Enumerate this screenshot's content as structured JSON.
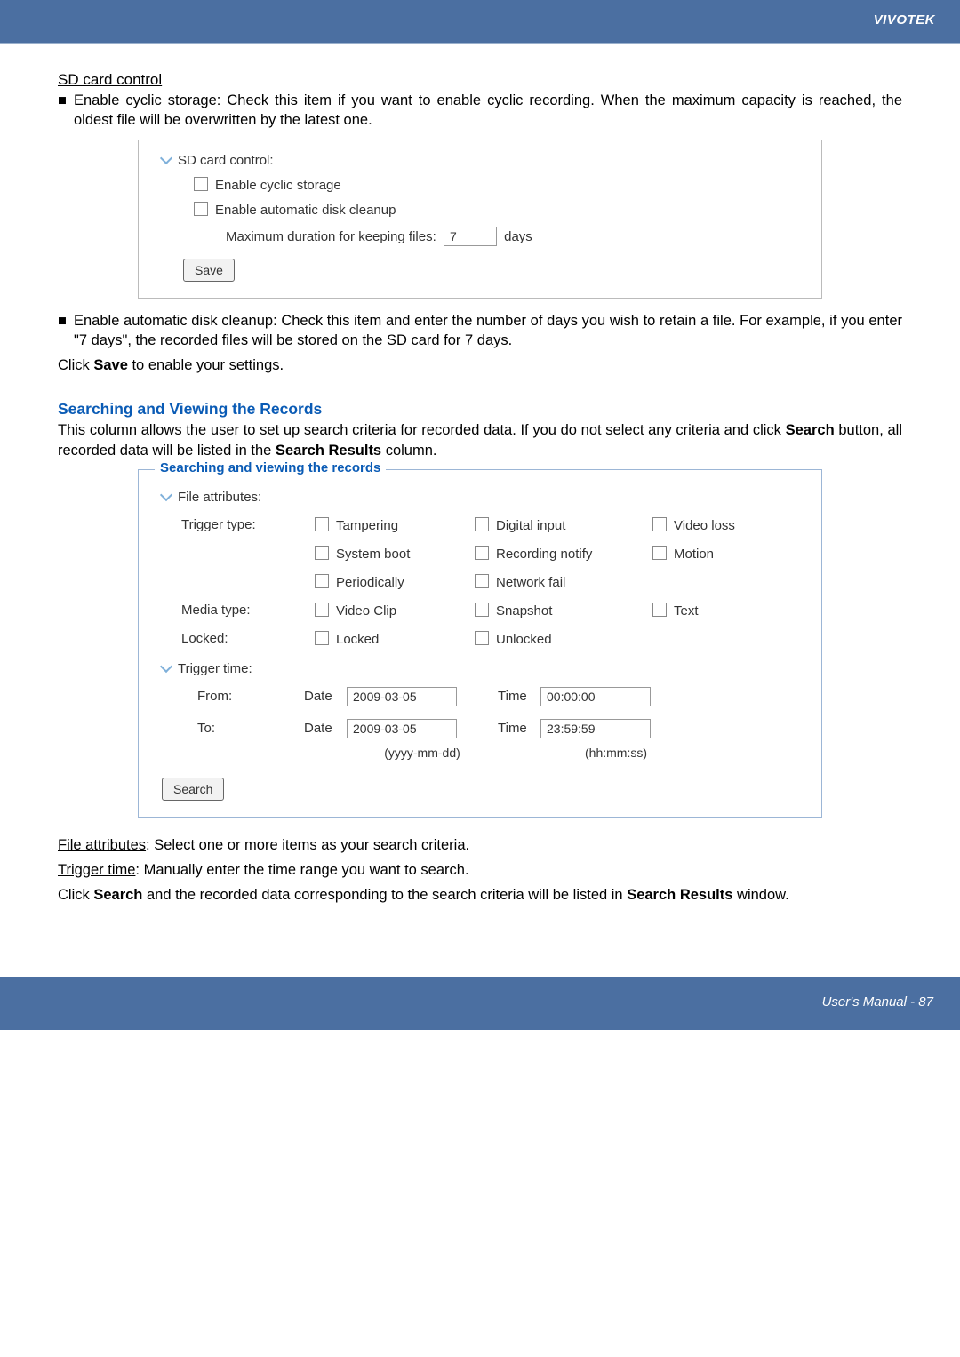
{
  "header": {
    "brand": "VIVOTEK"
  },
  "footer": {
    "text": "User's Manual - 87"
  },
  "sd": {
    "heading": "SD card control",
    "bullet1_a": "Enable cyclic storage: Check this item if you want to enable cyclic recording. When the maximum capacity is reached, the oldest file will be overwritten by the latest one.",
    "box": {
      "title": "SD card control:",
      "opt1": "Enable cyclic storage",
      "opt2": "Enable automatic disk cleanup",
      "mdk_label": "Maximum duration for keeping files:",
      "mdk_value": "7",
      "mdk_unit": "days",
      "save": "Save"
    },
    "bullet2": "Enable automatic disk cleanup: Check this item and enter the number of days you wish to retain a file. For example, if you enter \"7 days\", the recorded files will be stored on the SD card for 7 days.",
    "click_save_pre": "Click ",
    "click_save_bold": "Save",
    "click_save_post": " to enable your settings."
  },
  "search": {
    "title": "Searching and Viewing the Records",
    "intro_pre": "This column allows the user to set up search criteria for recorded data. If you do not select any criteria and click ",
    "intro_b1": "Search",
    "intro_mid": " button, all recorded data will be listed in the ",
    "intro_b2": "Search Results",
    "intro_post": " column.",
    "legend": "Searching and viewing the records",
    "box": {
      "file_attr": "File attributes:",
      "trigger_type": "Trigger type:",
      "tampering": "Tampering",
      "digital_input": "Digital input",
      "video_loss": "Video loss",
      "system_boot": "System boot",
      "recording_notify": "Recording notify",
      "motion": "Motion",
      "periodically": "Periodically",
      "network_fail": "Network fail",
      "media_type": "Media type:",
      "video_clip": "Video Clip",
      "snapshot": "Snapshot",
      "text": "Text",
      "locked_lbl": "Locked:",
      "locked": "Locked",
      "unlocked": "Unlocked",
      "trigger_time": "Trigger time:",
      "from": "From:",
      "to": "To:",
      "date_lbl": "Date",
      "time_lbl": "Time",
      "from_date": "2009-03-05",
      "from_time": "00:00:00",
      "to_date": "2009-03-05",
      "to_time": "23:59:59",
      "fmt_date": "(yyyy-mm-dd)",
      "fmt_time": "(hh:mm:ss)",
      "search_btn": "Search"
    },
    "file_attr_line_u": "File attributes",
    "file_attr_line_rest": ": Select one or more items as your search criteria.",
    "trigger_time_line_u": "Trigger time",
    "trigger_time_line_rest": ": Manually enter the time range you want to search.",
    "final_pre": "Click ",
    "final_b1": "Search",
    "final_mid": " and the recorded data corresponding to the search criteria will be listed in ",
    "final_b2": "Search Results",
    "final_post": " window."
  }
}
